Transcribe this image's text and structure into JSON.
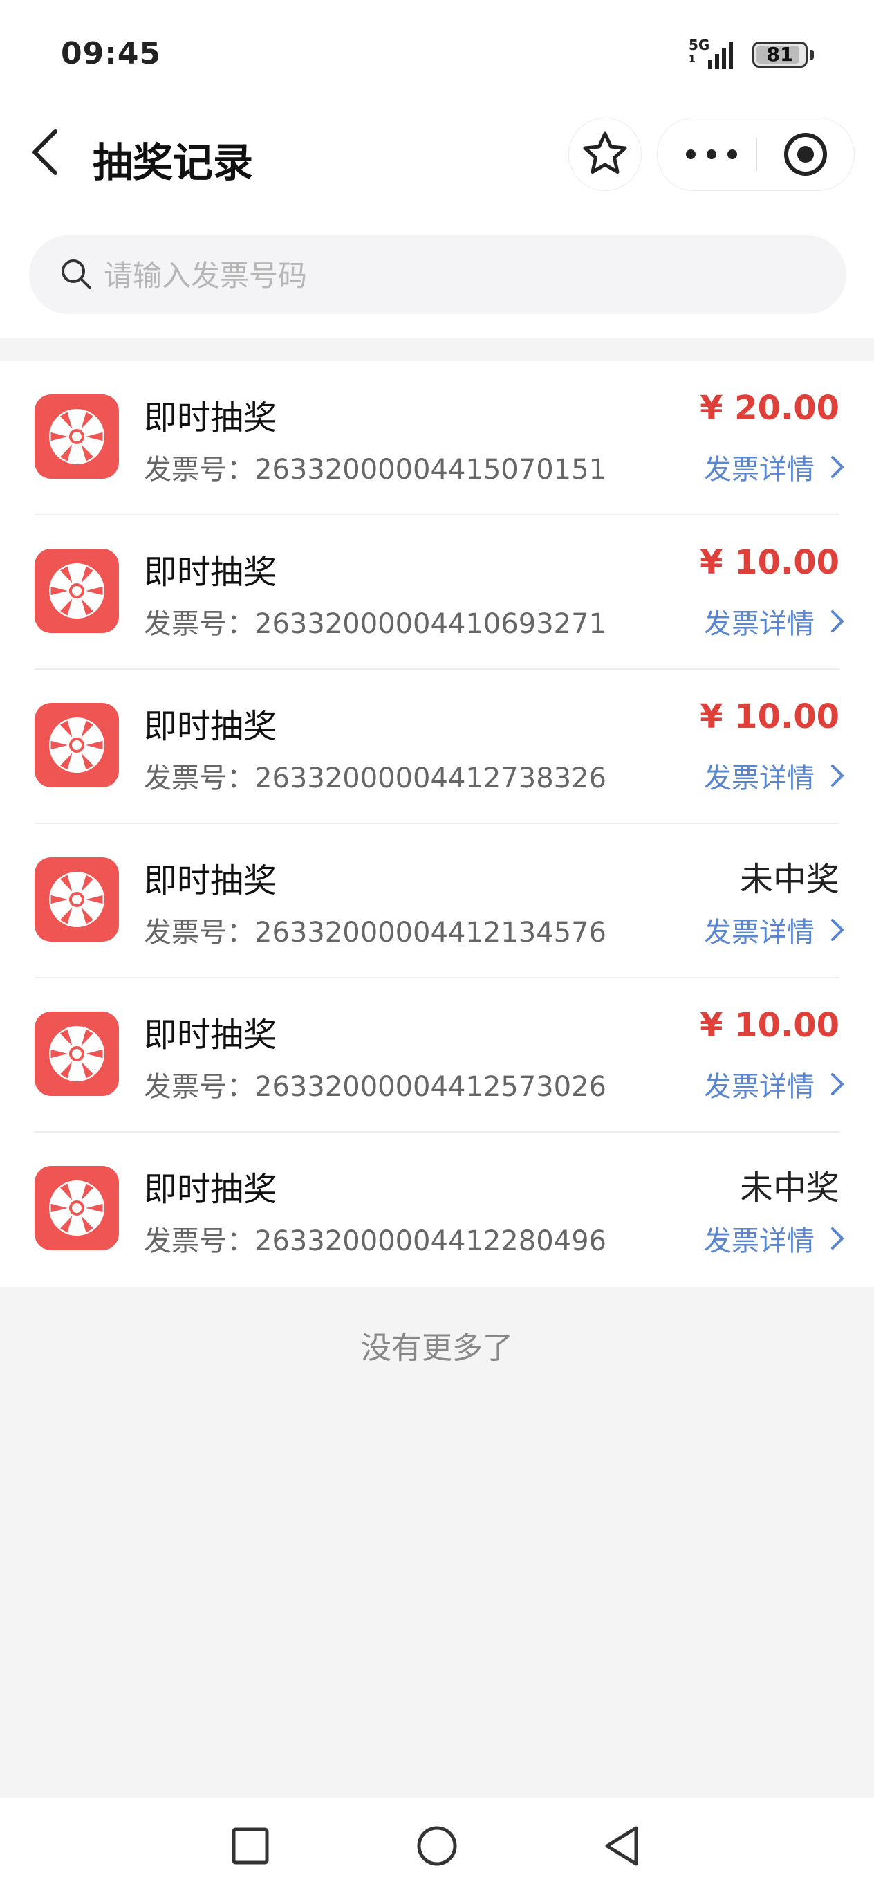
{
  "status_bar": {
    "time": "09:45",
    "network": "5G",
    "network_sub": "1",
    "battery": "81"
  },
  "header": {
    "title": "抽奖记录"
  },
  "search": {
    "placeholder": "请输入发票号码"
  },
  "records": [
    {
      "title": "即时抽奖",
      "invoice_label": "发票号：",
      "invoice_number": "26332000004415070151",
      "result": "¥ 20.00",
      "won": true,
      "detail_label": "发票详情"
    },
    {
      "title": "即时抽奖",
      "invoice_label": "发票号：",
      "invoice_number": "26332000004410693271",
      "result": "¥ 10.00",
      "won": true,
      "detail_label": "发票详情"
    },
    {
      "title": "即时抽奖",
      "invoice_label": "发票号：",
      "invoice_number": "26332000004412738326",
      "result": "¥ 10.00",
      "won": true,
      "detail_label": "发票详情"
    },
    {
      "title": "即时抽奖",
      "invoice_label": "发票号：",
      "invoice_number": "26332000004412134576",
      "result": "未中奖",
      "won": false,
      "detail_label": "发票详情"
    },
    {
      "title": "即时抽奖",
      "invoice_label": "发票号：",
      "invoice_number": "26332000004412573026",
      "result": "¥ 10.00",
      "won": true,
      "detail_label": "发票详情"
    },
    {
      "title": "即时抽奖",
      "invoice_label": "发票号：",
      "invoice_number": "26332000004412280496",
      "result": "未中奖",
      "won": false,
      "detail_label": "发票详情"
    }
  ],
  "footer": {
    "no_more": "没有更多了"
  },
  "icons": {
    "back": "chevron-left-icon",
    "favorite": "star-icon",
    "more": "more-dots-icon",
    "close": "target-icon",
    "search": "search-icon",
    "lottery": "wheel-icon",
    "detail": "chevron-right-icon"
  },
  "colors": {
    "accent_red": "#e0403a",
    "icon_bg": "#ef5552",
    "link_blue": "#5a86cf"
  }
}
